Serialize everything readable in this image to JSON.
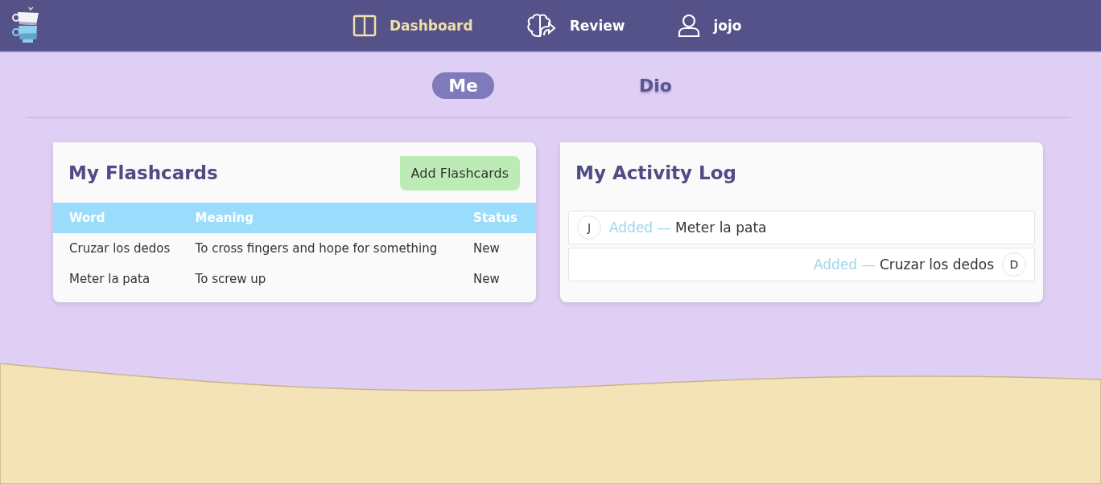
{
  "nav": [
    {
      "label": "Dashboard",
      "selected": true
    },
    {
      "label": "Review",
      "selected": false
    },
    {
      "label": "jojo",
      "selected": false
    }
  ],
  "tabs": [
    {
      "label": "Me",
      "selected": true
    },
    {
      "label": "Dio",
      "selected": false
    }
  ],
  "flashcards": {
    "title": "My Flashcards",
    "button": "Add Flashcards",
    "columns": [
      "Word",
      "Meaning",
      "Status"
    ],
    "rows": [
      [
        "Cruzar los dedos",
        "To cross fingers and hope for something",
        "New"
      ],
      [
        "Meter la pata",
        "To screw up",
        "New"
      ]
    ]
  },
  "activity": {
    "title": "My Activity Log",
    "entries": [
      {
        "kind": "incoming",
        "initial": "J",
        "action": "Added —",
        "word": "Meter la pata"
      },
      {
        "kind": "outgoing",
        "initial": "D",
        "action": "Added —",
        "word": "Cruzar los dedos"
      }
    ]
  }
}
